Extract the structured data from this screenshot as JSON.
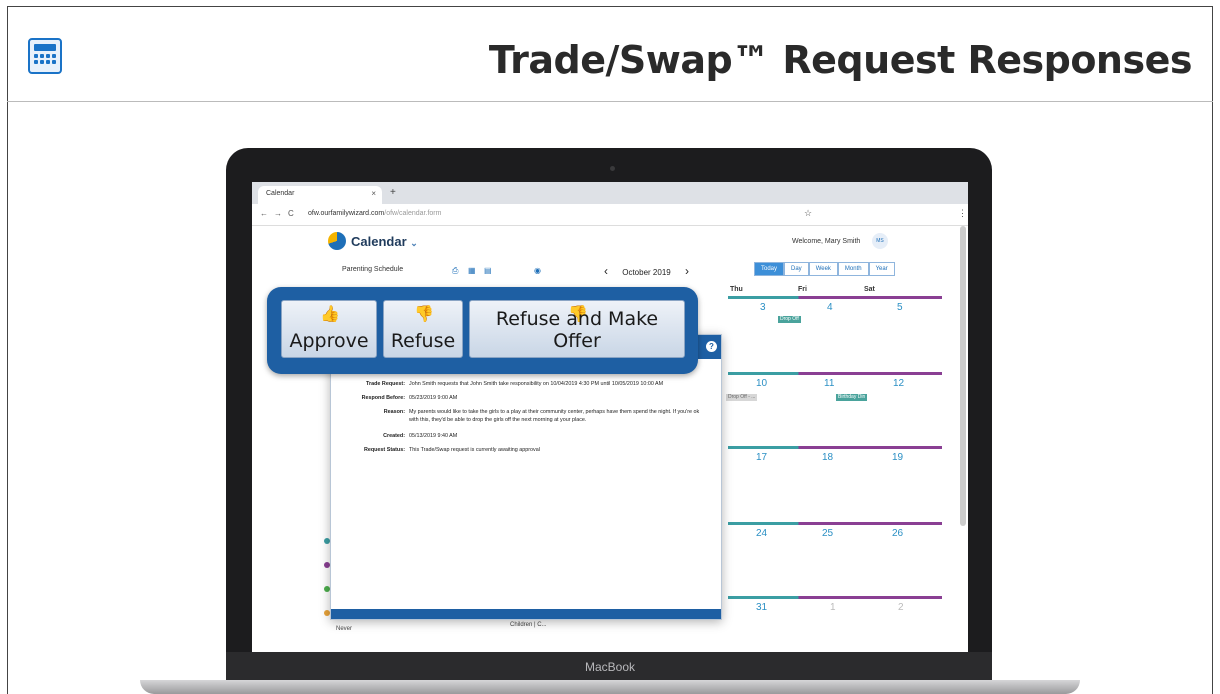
{
  "slide": {
    "title": "Trade/Swap™ Request Responses",
    "icon": "calculator-icon"
  },
  "laptop": {
    "brand": "MacBook"
  },
  "browser": {
    "tab_title": "Calendar",
    "tab_close": "×",
    "new_tab": "+",
    "back": "←",
    "forward": "→",
    "reload": "C",
    "url_main": "ofw.ourfamilywizard.com",
    "url_path": "/ofw/calendar.form",
    "bookmark": "☆",
    "menu": "⋮"
  },
  "app": {
    "title": "Calendar",
    "title_chevron": "⌄",
    "welcome": "Welcome, Mary Smith",
    "avatar_initials": "MS",
    "toolbar_label": "Parenting Schedule",
    "month_label": "October 2019",
    "prev": "‹",
    "next": "›",
    "views": [
      "Today",
      "Day",
      "Week",
      "Month",
      "Year"
    ],
    "active_view": "Today"
  },
  "calendar": {
    "headers": [
      "Thu",
      "Fri",
      "Sat"
    ],
    "days": [
      [
        "3",
        "4",
        "5"
      ],
      [
        "10",
        "11",
        "12"
      ],
      [
        "17",
        "18",
        "19"
      ],
      [
        "24",
        "25",
        "26"
      ],
      [
        "31",
        "1",
        "2"
      ]
    ],
    "events": {
      "row1_fri": "Drop Off",
      "row2_thu": "Drop Off - ...",
      "row2_sat": "Birthday Din",
      "bottom_left": "Never",
      "bottom_mid": "Children | C..."
    }
  },
  "dialog": {
    "help": "?",
    "rows": [
      {
        "label": "Trade Request:",
        "value": "John Smith requests that John Smith take responsibility on 10/04/2019 4:30 PM until 10/05/2019 10:00 AM"
      },
      {
        "label": "Respond Before:",
        "value": "05/23/2019 9:00 AM"
      },
      {
        "label": "Reason:",
        "value": "My parents would like to take the girls to a play at their community center, perhaps have them spend the night. If you're ok with this, they'd be able to drop the girls off the next morning at your place."
      },
      {
        "label": "Created:",
        "value": "05/13/2019 9:40 AM"
      },
      {
        "label": "Request Status:",
        "value": "This Trade/Swap request is currently awaiting approval"
      }
    ]
  },
  "callout": {
    "approve": "Approve",
    "refuse": "Refuse",
    "refuse_offer": "Refuse and Make Offer"
  },
  "colors": {
    "brand_blue": "#1e5fa3",
    "teal": "#3b9ea3",
    "purple": "#8a3f93"
  }
}
